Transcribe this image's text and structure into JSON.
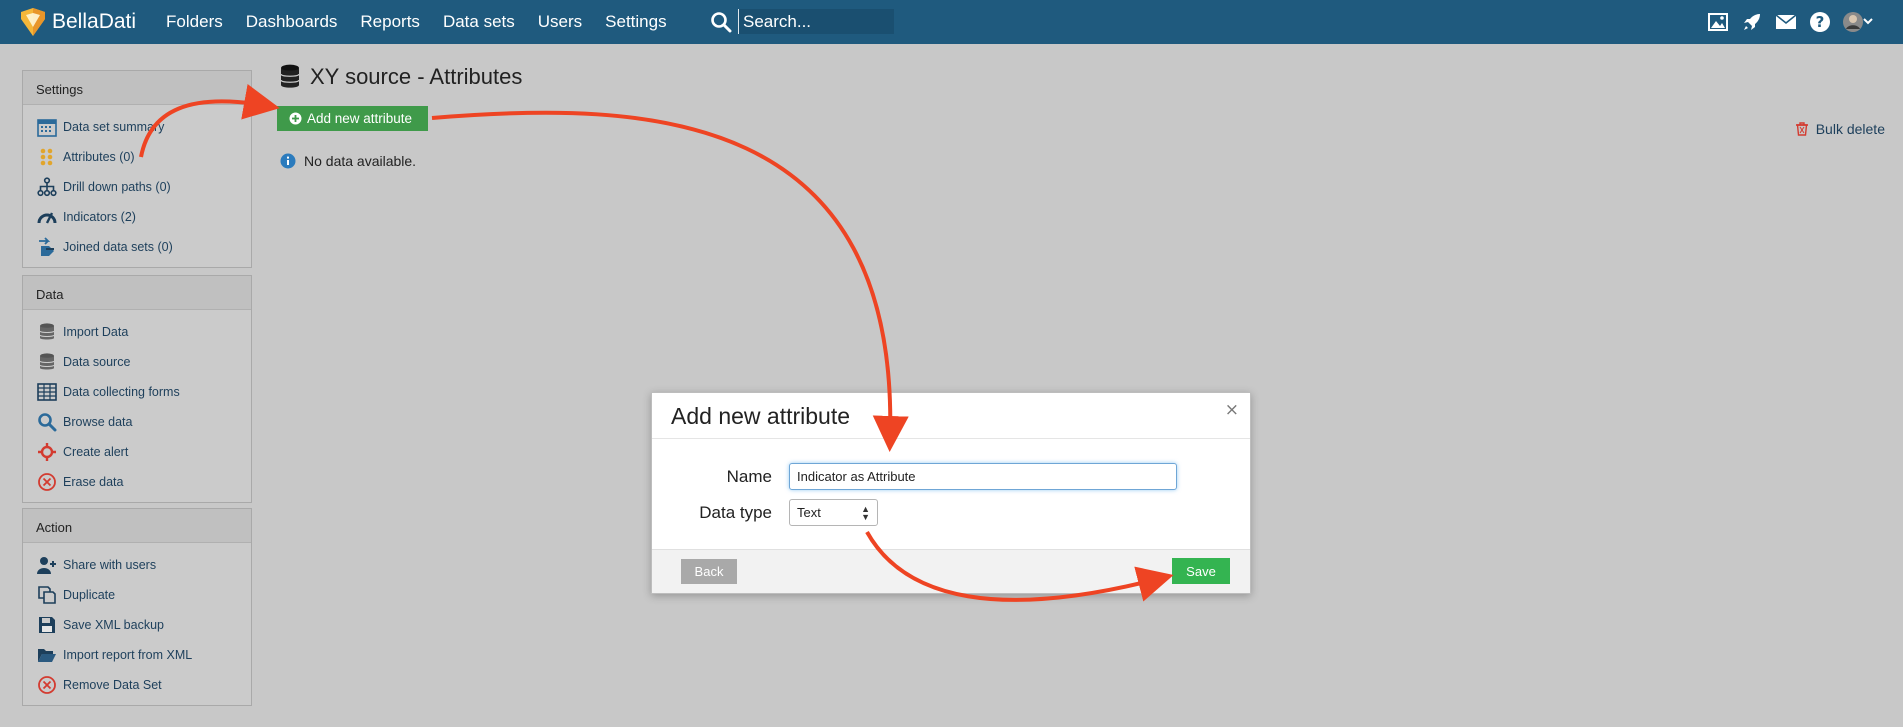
{
  "app": {
    "brand": "BellaDati"
  },
  "nav": {
    "items": [
      "Folders",
      "Dashboards",
      "Reports",
      "Data sets",
      "Users",
      "Settings"
    ]
  },
  "search": {
    "placeholder": "Search..."
  },
  "top_icons": [
    "image-icon",
    "rocket-icon",
    "mail-icon",
    "help-icon",
    "avatar"
  ],
  "sidebar": {
    "settings": {
      "title": "Settings",
      "items": [
        {
          "label": "Data set summary",
          "icon": "calendar-icon"
        },
        {
          "label": "Attributes (0)",
          "icon": "attributes-icon"
        },
        {
          "label": "Drill down paths (0)",
          "icon": "hierarchy-icon"
        },
        {
          "label": "Indicators (2)",
          "icon": "gauge-icon"
        },
        {
          "label": "Joined data sets (0)",
          "icon": "join-icon"
        }
      ]
    },
    "data": {
      "title": "Data",
      "items": [
        {
          "label": "Import Data",
          "icon": "database-icon"
        },
        {
          "label": "Data source",
          "icon": "database-icon"
        },
        {
          "label": "Data collecting forms",
          "icon": "grid-icon"
        },
        {
          "label": "Browse data",
          "icon": "search-icon"
        },
        {
          "label": "Create alert",
          "icon": "alert-icon"
        },
        {
          "label": "Erase data",
          "icon": "erase-icon"
        }
      ]
    },
    "action": {
      "title": "Action",
      "items": [
        {
          "label": "Share with users",
          "icon": "add-user-icon"
        },
        {
          "label": "Duplicate",
          "icon": "duplicate-icon"
        },
        {
          "label": "Save XML backup",
          "icon": "save-icon"
        },
        {
          "label": "Import report from XML",
          "icon": "folder-open-icon"
        },
        {
          "label": "Remove Data Set",
          "icon": "remove-icon"
        }
      ]
    }
  },
  "main": {
    "title": "XY source - Attributes",
    "add_button": "Add new attribute",
    "bulk_delete": "Bulk delete",
    "no_data": "No data available."
  },
  "modal": {
    "title": "Add new attribute",
    "close": "×",
    "name_label": "Name",
    "name_value": "Indicator as Attribute",
    "type_label": "Data type",
    "type_value": "Text",
    "back": "Back",
    "save": "Save"
  },
  "colors": {
    "topbar": "#1f5a7e",
    "accent_green": "#34b451",
    "annotation_arrow": "#ee4423"
  }
}
